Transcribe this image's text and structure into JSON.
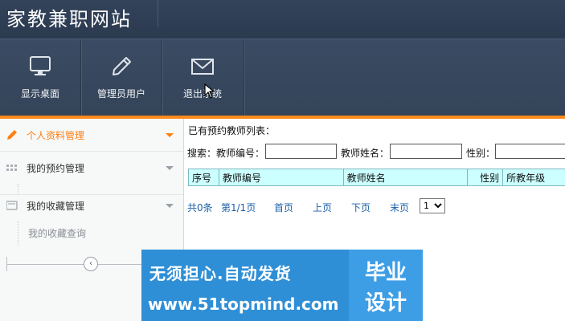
{
  "header": {
    "site_title": "家教兼职网站"
  },
  "toolbar": {
    "items": [
      {
        "label": "显示桌面",
        "icon": "monitor-icon"
      },
      {
        "label": "管理员用户",
        "icon": "pencil-icon"
      },
      {
        "label": "退出系统",
        "icon": "envelope-icon"
      }
    ]
  },
  "sidebar": {
    "items": [
      {
        "label": "个人资料管理",
        "icon": "pencil-icon",
        "active": true
      },
      {
        "label": "我的预约管理",
        "icon": "grid-icon",
        "active": false
      },
      {
        "label": "我的收藏管理",
        "icon": "folder-icon",
        "active": false
      }
    ],
    "sub_items": [
      "我的收藏查询"
    ],
    "collapse_symbol": "‹"
  },
  "main": {
    "list_title": "已有预约教师列表：",
    "search": {
      "prefix": "搜索：",
      "teacher_no_label": "教师编号：",
      "teacher_name_label": "教师姓名：",
      "gender_label": "性别：",
      "teacher_no_value": "",
      "teacher_name_value": "",
      "gender_value": ""
    },
    "table": {
      "columns": [
        "序号",
        "教师编号",
        "教师姓名",
        "性别",
        "所教年级"
      ]
    },
    "pager": {
      "total": "共0条",
      "page_info": "第1/1页",
      "first": "首页",
      "prev": "上页",
      "next": "下页",
      "last": "末页",
      "page_select_value": "1"
    }
  },
  "watermark": {
    "line1": "无须担心.自动发货",
    "line2": "www.51topmind.com",
    "stamp_top": "毕业",
    "stamp_bottom": "设计"
  },
  "colors": {
    "header_bg": "#2b3a4f",
    "accent": "#ff8a1c",
    "table_header_bg": "#ccffff",
    "link": "#1d5fa8",
    "watermark_bg": "#2f8fd6"
  }
}
